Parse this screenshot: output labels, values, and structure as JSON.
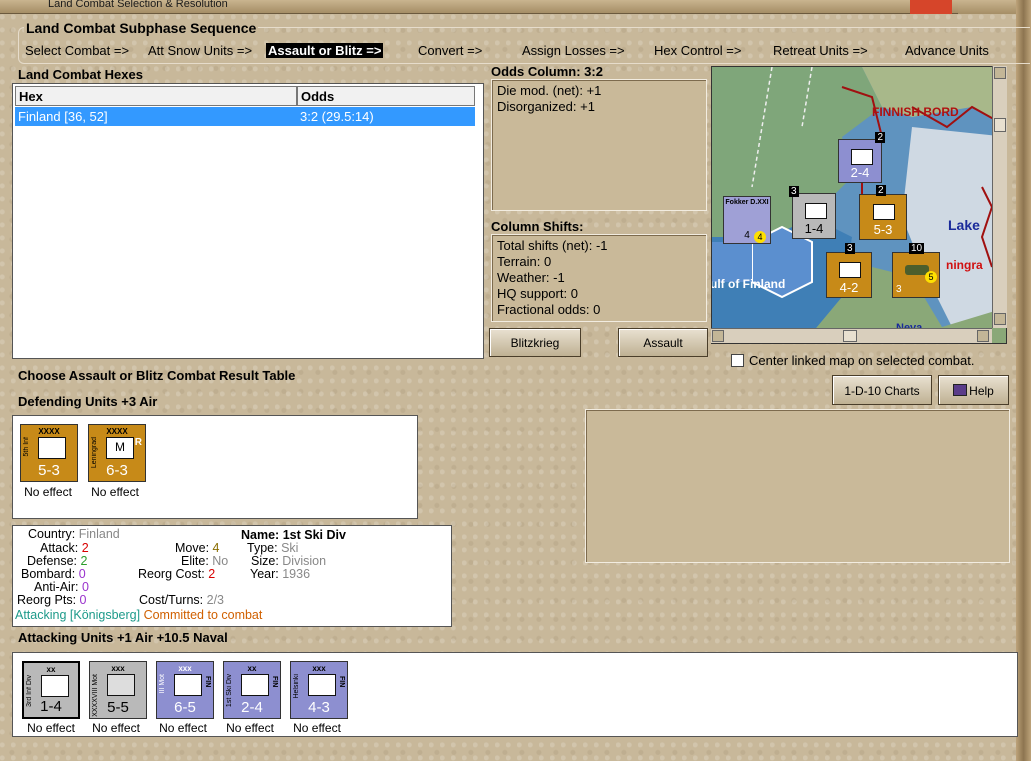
{
  "window": {
    "title": "Land Combat Selection & Resolution"
  },
  "sequence": {
    "title": "Land Combat Subphase Sequence",
    "steps": [
      "Select Combat =>",
      "Att Snow Units =>",
      "Assault or Blitz =>",
      "Convert =>",
      "Assign Losses =>",
      "Hex Control =>",
      "Retreat Units =>",
      "Advance Units"
    ]
  },
  "hexes": {
    "title": "Land Combat Hexes",
    "columns": [
      "Hex",
      "Odds"
    ],
    "rows": [
      {
        "hex": "Finland [36, 52]",
        "odds": "3:2 (29.5:14)"
      }
    ]
  },
  "odds": {
    "title": "Odds Column: 3:2",
    "lines": [
      "Die mod. (net): +1",
      "Disorganized: +1"
    ]
  },
  "shifts": {
    "title": "Column Shifts:",
    "lines": [
      "Total shifts (net): -1",
      "Terrain: 0",
      "Weather: -1",
      "HQ support: 0",
      "Fractional odds: 0"
    ]
  },
  "buttons": {
    "blitzkrieg": "Blitzkrieg",
    "assault": "Assault",
    "charts": "1-D-10 Charts",
    "help": "Help"
  },
  "center_map": {
    "label": "Center linked map on selected combat.",
    "checked": false
  },
  "map": {
    "labels": [
      "FINNISH BORD",
      "Lake",
      "ningra",
      "ulf of Finland",
      "Neva"
    ],
    "units": [
      {
        "name": "Fokker D.XXI",
        "str": "4",
        "num": "4"
      },
      {
        "name": "1st Ski Div",
        "str": "2-4",
        "stack": "2"
      },
      {
        "name": "3rd Inf Div",
        "str": "1-4",
        "stack": "3"
      },
      {
        "name": "",
        "str": "5-3",
        "stack": "2"
      },
      {
        "name": "",
        "str": "4-2",
        "stack": "3"
      },
      {
        "name": "Su-2",
        "str": "3",
        "stack": "10",
        "num": "5"
      }
    ]
  },
  "crt": {
    "title": "Choose Assault or Blitz Combat Result Table"
  },
  "defending": {
    "title": "Defending Units +3 Air",
    "units": [
      {
        "name": "5th Inf",
        "size": "XXXX",
        "str": "5-3",
        "symbol": "",
        "result": "No effect"
      },
      {
        "name": "Leningrad",
        "size": "XXXX",
        "str": "6-3",
        "symbol": "M",
        "tag": "R",
        "result": "No effect"
      }
    ]
  },
  "info": {
    "country_label": "Country:",
    "country": "Finland",
    "attack_label": "Attack:",
    "attack": "2",
    "defense_label": "Defense:",
    "defense": "2",
    "bombard_label": "Bombard:",
    "bombard": "0",
    "antiair_label": "Anti-Air:",
    "antiair": "0",
    "reorg_label": "Reorg Pts:",
    "reorg": "0",
    "move_label": "Move:",
    "move": "4",
    "elite_label": "Elite:",
    "elite": "No",
    "reorgcost_label": "Reorg Cost:",
    "reorgcost": "2",
    "costturns_label": "Cost/Turns:",
    "costturns": "2/3",
    "name_label": "Name:",
    "name": "1st Ski Div",
    "type_label": "Type:",
    "type": "Ski",
    "size_label": "Size:",
    "size": "Division",
    "year_label": "Year:",
    "year": "1936",
    "status_attacking": "Attacking [Königsberg]",
    "status_committed": "Committed to combat"
  },
  "attacking": {
    "title": "Attacking Units +1 Air +10.5 Naval",
    "units": [
      {
        "name": "3rd Inf Div",
        "size": "xx",
        "str": "1-4",
        "result": "No effect",
        "nat": ""
      },
      {
        "name": "XXXXVIII Mot",
        "size": "xxx",
        "str": "5-5",
        "result": "No effect",
        "nat": ""
      },
      {
        "name": "III Mot",
        "size": "xxx",
        "str": "6-5",
        "result": "No effect",
        "nat": "FIN"
      },
      {
        "name": "1st Ski Div",
        "size": "xx",
        "str": "2-4",
        "result": "No effect",
        "nat": "FIN"
      },
      {
        "name": "Helsinki",
        "size": "xxx",
        "str": "4-3",
        "result": "No effect",
        "nat": "FIN"
      }
    ]
  },
  "colors": {
    "selection": "#3399ff",
    "gold": "#c78a18",
    "purple": "#8d8fd0"
  }
}
